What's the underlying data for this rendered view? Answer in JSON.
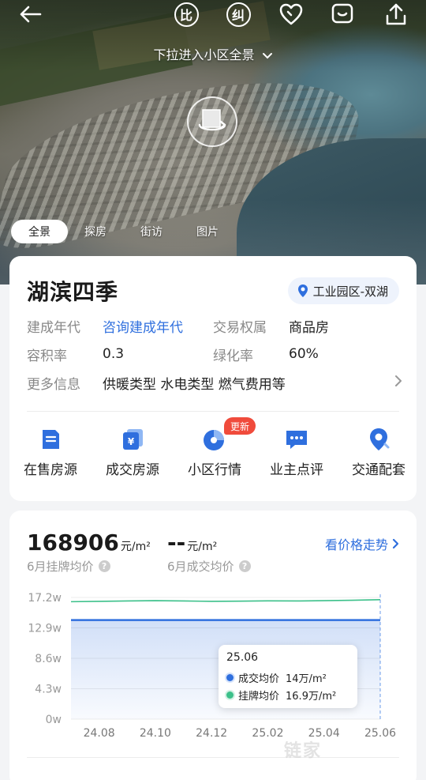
{
  "topbar": {
    "back_icon": "back-arrow-icon",
    "compare_label": "比",
    "correct_label": "纠",
    "favorite_icon": "heart-icon",
    "chat_icon": "chat-icon",
    "share_icon": "share-icon"
  },
  "hero": {
    "pull_hint": "下拉进入小区全景",
    "rotate_icon": "panorama-360-icon",
    "tabs": [
      {
        "label": "全景",
        "active": true
      },
      {
        "label": "探房",
        "active": false
      },
      {
        "label": "街访",
        "active": false
      },
      {
        "label": "图片",
        "active": false
      }
    ]
  },
  "estate": {
    "name": "湖滨四季",
    "location": "工业园区-双湖",
    "attributes": [
      {
        "label": "建成年代",
        "value": "咨询建成年代",
        "link": true
      },
      {
        "label": "交易权属",
        "value": "商品房"
      },
      {
        "label": "容积率",
        "value": "0.3"
      },
      {
        "label": "绿化率",
        "value": "60%"
      },
      {
        "label": "更多信息",
        "value": "供暖类型 水电类型 燃气费用等"
      }
    ]
  },
  "quick_nav": [
    {
      "label": "在售房源",
      "icon": "listing-icon"
    },
    {
      "label": "成交房源",
      "icon": "deal-icon"
    },
    {
      "label": "小区行情",
      "icon": "market-icon",
      "badge": "更新"
    },
    {
      "label": "业主点评",
      "icon": "review-icon"
    },
    {
      "label": "交通配套",
      "icon": "location-pin-icon"
    }
  ],
  "price": {
    "listing_avg": "168906",
    "listing_unit": "元/m²",
    "listing_caption": "6月挂牌均价",
    "deal_avg": "--",
    "deal_unit": "元/m²",
    "deal_caption": "6月成交均价",
    "trend_link": "看价格走势",
    "tooltip": {
      "date": "25.06",
      "deal_label": "成交均价",
      "deal_value": "14万/m²",
      "listing_label": "挂牌均价",
      "listing_value": "16.9万/m²"
    }
  },
  "colors": {
    "accent": "#2f6fde",
    "deal_series": "#2f6fde",
    "listing_series": "#3cc08a",
    "badge": "#f04b3c"
  },
  "chart_data": {
    "type": "line",
    "x": [
      "24.07",
      "24.08",
      "24.09",
      "24.10",
      "24.11",
      "24.12",
      "25.01",
      "25.02",
      "25.03",
      "25.04",
      "25.05",
      "25.06"
    ],
    "xticks": [
      "24.08",
      "24.10",
      "24.12",
      "25.02",
      "25.04",
      "25.06"
    ],
    "yticks": [
      "0w",
      "4.3w",
      "8.6w",
      "12.9w",
      "17.2w"
    ],
    "ylim": [
      0,
      172000
    ],
    "series": [
      {
        "name": "挂牌均价",
        "values": [
          166000,
          166500,
          167000,
          167500,
          167000,
          166500,
          166800,
          167200,
          167000,
          167500,
          168000,
          168906
        ]
      },
      {
        "name": "成交均价",
        "values": [
          140000,
          140000,
          140000,
          140000,
          140000,
          140000,
          140000,
          140000,
          140000,
          140000,
          140000,
          140000
        ]
      }
    ],
    "grid": true
  },
  "watermark": "链家"
}
